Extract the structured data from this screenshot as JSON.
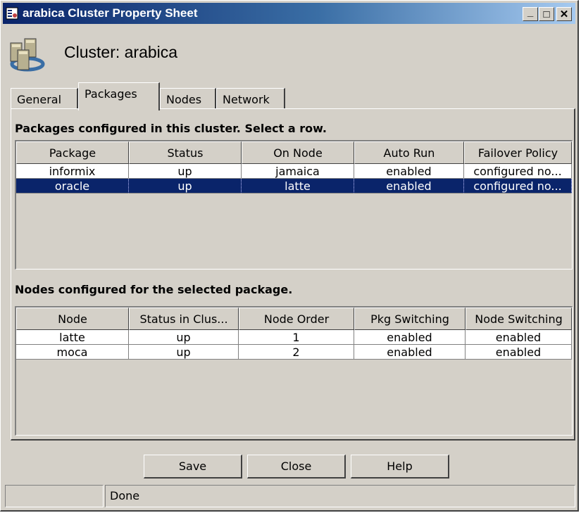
{
  "window": {
    "title": "arabica Cluster Property Sheet",
    "title_icon": "property-sheet-icon",
    "controls": {
      "minimize": "_",
      "maximize": "□",
      "close": "✕"
    }
  },
  "header": {
    "icon": "cluster-icon",
    "title": "Cluster: arabica"
  },
  "tabs": [
    {
      "label": "General",
      "active": false
    },
    {
      "label": "Packages",
      "active": true
    },
    {
      "label": "Nodes",
      "active": false
    },
    {
      "label": "Network",
      "active": false
    }
  ],
  "packages_section": {
    "title": "Packages configured in this cluster. Select a row.",
    "columns": [
      "Package",
      "Status",
      "On Node",
      "Auto Run",
      "Failover Policy"
    ],
    "rows": [
      [
        "informix",
        "up",
        "jamaica",
        "enabled",
        "configured no..."
      ],
      [
        "oracle",
        "up",
        "latte",
        "enabled",
        "configured no..."
      ]
    ],
    "selected_row": 1
  },
  "nodes_section": {
    "title": "Nodes configured for the selected package.",
    "columns": [
      "Node",
      "Status in Clus...",
      "Node Order",
      "Pkg Switching",
      "Node Switching"
    ],
    "rows": [
      [
        "latte",
        "up",
        "1",
        "enabled",
        "enabled"
      ],
      [
        "moca",
        "up",
        "2",
        "enabled",
        "enabled"
      ]
    ]
  },
  "buttons": {
    "save": "Save",
    "close": "Close",
    "help": "Help"
  },
  "status": {
    "left": "",
    "message": "Done"
  },
  "colors": {
    "selection": "#0a246a",
    "dialog_bg": "#d4d0c8",
    "title_start": "#0a246a",
    "title_end": "#a6caf0"
  }
}
